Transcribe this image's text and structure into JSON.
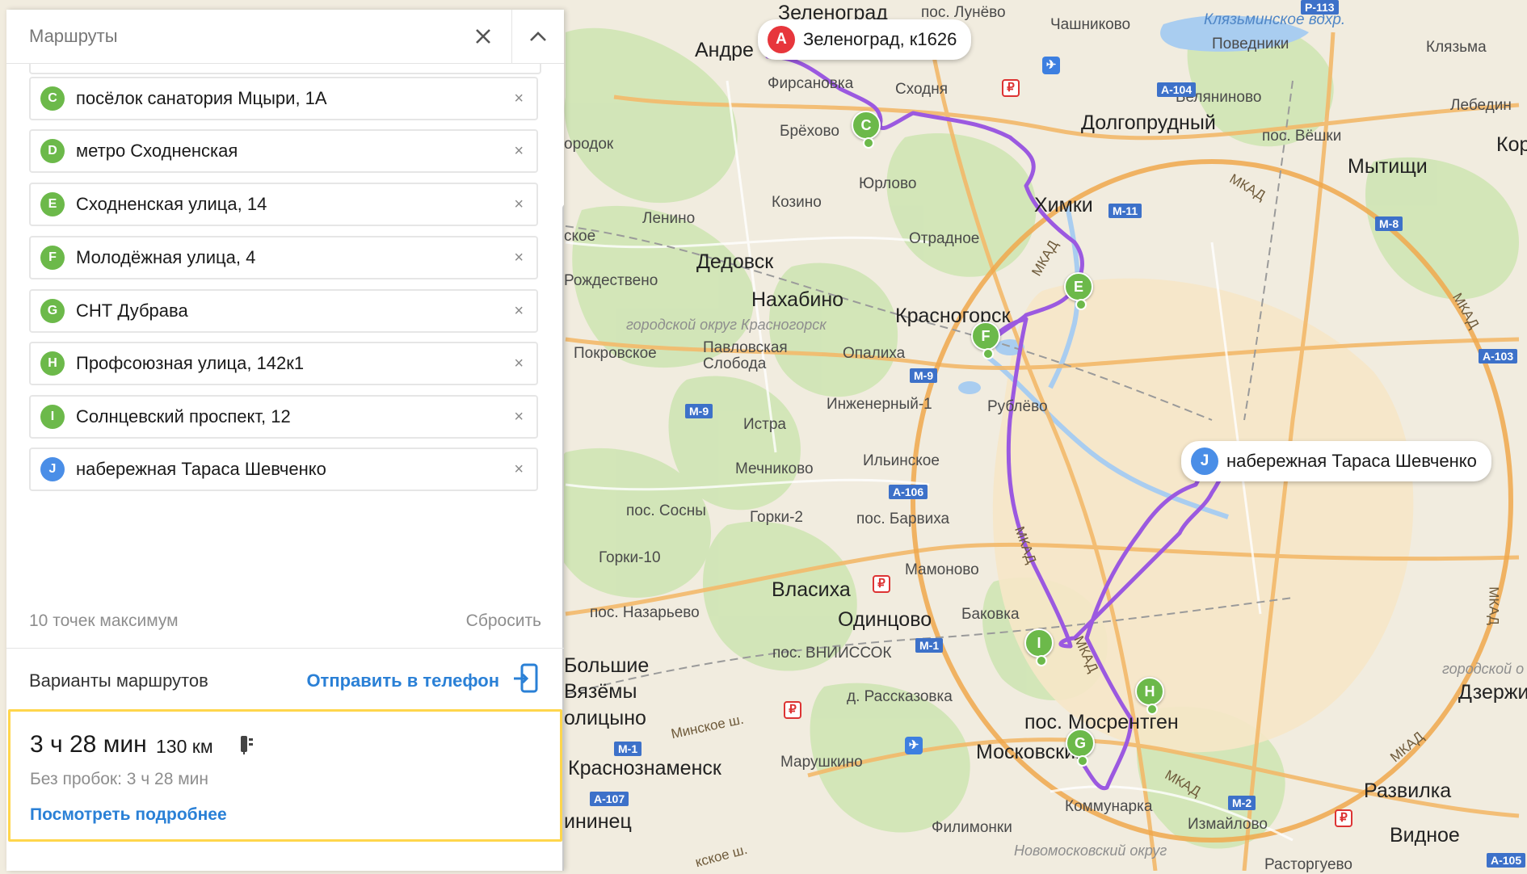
{
  "panel": {
    "title": "Маршруты",
    "close_icon": "close-icon",
    "collapse_icon": "chevron-up-icon",
    "waypoints": [
      {
        "letter": "C",
        "label": "посёлок санатория Мцыри, 1А",
        "color": "#6cb94a"
      },
      {
        "letter": "D",
        "label": "метро Сходненская",
        "color": "#6cb94a"
      },
      {
        "letter": "E",
        "label": "Сходненская улица, 14",
        "color": "#6cb94a"
      },
      {
        "letter": "F",
        "label": "Молодёжная улица, 4",
        "color": "#6cb94a"
      },
      {
        "letter": "G",
        "label": "СНТ Дубрава",
        "color": "#6cb94a"
      },
      {
        "letter": "H",
        "label": "Профсоюзная улица, 142к1",
        "color": "#6cb94a"
      },
      {
        "letter": "I",
        "label": "Солнцевский проспект, 12",
        "color": "#6cb94a"
      },
      {
        "letter": "J",
        "label": "набережная Тараса Шевченко",
        "color": "#4a8ee7"
      }
    ],
    "remove_glyph": "×",
    "limit_note": "10 точек максимум",
    "reset_label": "Сбросить",
    "variants_title": "Варианты маршрутов",
    "send_to_phone": "Отправить в телефон",
    "route": {
      "time": "3 ч 28 мин",
      "distance": "130 км",
      "no_traffic": "Без пробок: 3 ч 28 мин",
      "details_link": "Посмотреть подробнее"
    }
  },
  "map": {
    "route_color": "#9b59e0",
    "callouts": {
      "a": {
        "letter": "A",
        "label": "Зеленоград, к1626",
        "color": "#e7363c"
      },
      "j": {
        "letter": "J",
        "label": "набережная Тараса Шевченко",
        "color": "#4a8ee7"
      }
    },
    "pins": [
      "C",
      "E",
      "F",
      "I",
      "G",
      "H"
    ],
    "places": {
      "zelenograd": "Зеленоград",
      "lunevo": "пос. Лунёво",
      "chashnikovo": "Чашниково",
      "klyazminskoe": "Клязьминское вдхр.",
      "klyazma": "Клязьма",
      "andre": "Андре",
      "povedniki": "Поведники",
      "firsanovka": "Фирсановка",
      "skhodnya": "Сходня",
      "belyaninovo": "Беляниново",
      "dolgoprudny": "Долгопрудный",
      "pos_veshki": "пос. Вёшки",
      "mytishchi": "Мытищи",
      "korolev": "Коро",
      "lebedin": "Лебедин",
      "brekhovo": "Брёхово",
      "orodok": "ородок",
      "yurlovo": "Юрлово",
      "khimki": "Химки",
      "kozino": "Козино",
      "lenino": "Ленино",
      "otradnoe": "Отрадное",
      "skoe": "ское",
      "dedovsk": "Дедовск",
      "rozhdestveno": "Рождествено",
      "nakhabino": "Нахабино",
      "krasnogorsk": "Красногорск",
      "go_krasnogorsk": "городской округ Красногорск",
      "pokrovskoe": "Покровское",
      "pavlovskaya": "Павловская",
      "sloboda": "Слобода",
      "opalikha": "Опалиха",
      "inzhenerny": "Инженерный-1",
      "rublevo": "Рублёво",
      "istra": "Истра",
      "ilinskoe": "Ильинское",
      "mechnikovo": "Мечниково",
      "pos_sosny": "пос. Сосны",
      "gorki2": "Горки-2",
      "pos_barvikha": "пос. Барвиха",
      "gorki10": "Горки-10",
      "mamonovo": "Мамоново",
      "vlasikha": "Власиха",
      "pos_nazarevo": "пос. Назарьево",
      "odintsovo": "Одинцово",
      "bakovka": "Баковка",
      "bolshie": "Большие",
      "vyazemy": "Вязёмы",
      "pos_vniissok": "пос. ВНИИССОК",
      "golitsyno": "олицыно",
      "d_rasskazovka": "д. Рассказовка",
      "minskoe": "Минское ш.",
      "pos_mosrentgen": "пос. Мосрентген",
      "moskovsky": "Московский",
      "marushkino": "Марушкино",
      "krasnoznamensk": "Краснознаменск",
      "kommunarka": "Коммунарка",
      "filimonki": "Филимонки",
      "izmailovo": "Измайлово",
      "vidnoe": "Видное",
      "razvilka": "Развилка",
      "dzerzhin": "Дзержин",
      "ininets": "ининец",
      "kskoe": "кское ш.",
      "novomoskovsky": "Новомосковский округ",
      "rastorguevo": "Расторгуево",
      "gorodskoy": "городской о",
      "mkad": "МКАД"
    },
    "shields": [
      "Р-113",
      "А-104",
      "М-11",
      "М-8",
      "А-103",
      "М-9",
      "М-9",
      "А-106",
      "М-1",
      "М-1",
      "А-107",
      "М-2",
      "А-105"
    ]
  }
}
